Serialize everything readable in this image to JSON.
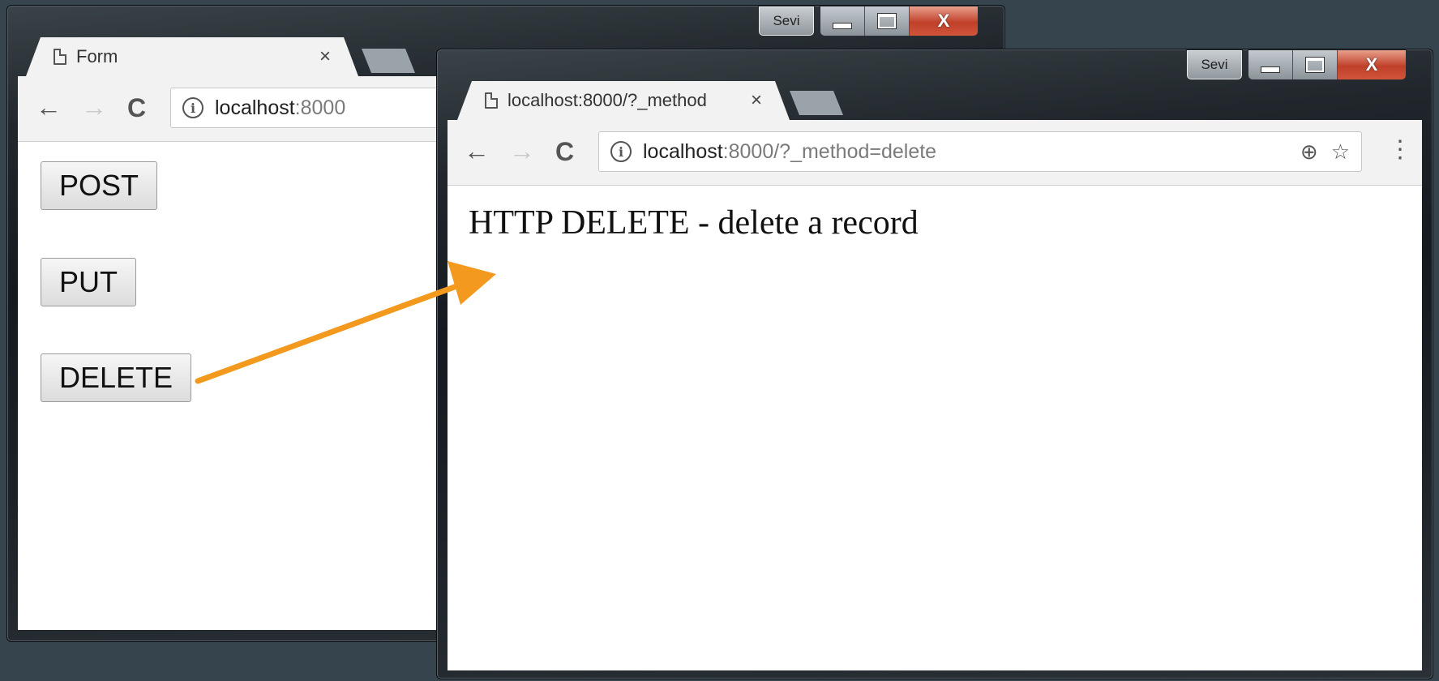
{
  "back_window": {
    "user_badge": "Sevi",
    "tab": {
      "title": "Form",
      "close": "×"
    },
    "toolbar": {
      "back": "←",
      "forward": "→",
      "reload": "C",
      "url_host": "localhost",
      "url_rest": ":8000"
    },
    "buttons": {
      "post": "POST",
      "put": "PUT",
      "delete": "DELETE"
    }
  },
  "front_window": {
    "user_badge": "Sevi",
    "tab": {
      "title": "localhost:8000/?_method",
      "close": "×"
    },
    "toolbar": {
      "back": "←",
      "forward": "→",
      "reload": "C",
      "url_host": "localhost",
      "url_rest": ":8000/?_method=delete",
      "zoom": "⊕",
      "star": "☆",
      "menu": "⋮"
    },
    "body_text": "HTTP DELETE - delete a record"
  },
  "window_controls": {
    "minimize": "",
    "maximize": "",
    "close": "X"
  },
  "annotation": {
    "arrow_color": "#f39a1e"
  },
  "icons": [
    "page-icon",
    "back-arrow-icon",
    "forward-arrow-icon",
    "reload-icon",
    "info-icon",
    "zoom-icon",
    "star-icon",
    "menu-icon",
    "minimize-icon",
    "maximize-icon",
    "close-icon"
  ]
}
